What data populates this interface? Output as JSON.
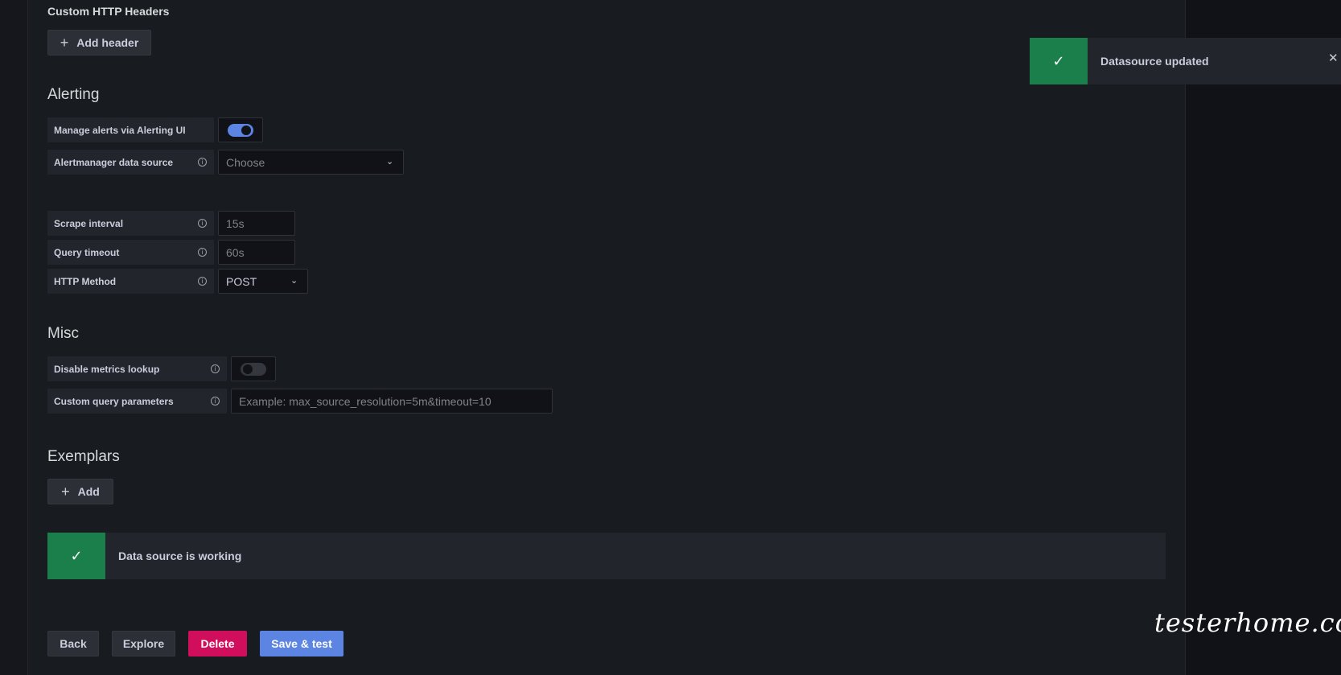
{
  "http_headers": {
    "title": "Custom HTTP Headers",
    "add_header_label": "Add header"
  },
  "alerting": {
    "title": "Alerting",
    "manage_alerts_label": "Manage alerts via Alerting UI",
    "manage_alerts_enabled": true,
    "alertmanager_label": "Alertmanager data source",
    "alertmanager_placeholder": "Choose"
  },
  "settings": {
    "scrape_interval_label": "Scrape interval",
    "scrape_interval_placeholder": "15s",
    "query_timeout_label": "Query timeout",
    "query_timeout_placeholder": "60s",
    "http_method_label": "HTTP Method",
    "http_method_value": "POST"
  },
  "misc": {
    "title": "Misc",
    "disable_metrics_label": "Disable metrics lookup",
    "disable_metrics_enabled": false,
    "custom_query_label": "Custom query parameters",
    "custom_query_placeholder": "Example: max_source_resolution=5m&timeout=10"
  },
  "exemplars": {
    "title": "Exemplars",
    "add_label": "Add"
  },
  "status": {
    "message": "Data source is working"
  },
  "actions": {
    "back": "Back",
    "explore": "Explore",
    "delete": "Delete",
    "save_test": "Save & test"
  },
  "toast": {
    "message": "Datasource updated"
  },
  "watermark": "testerhome.com",
  "colors": {
    "success": "#1a7f4b",
    "primary": "#5b84e3",
    "danger": "#d10e5c",
    "toggle_on": "#5b84e3"
  },
  "icons": {
    "check": "check-icon",
    "plus": "plus-icon",
    "info": "info-icon",
    "chevron": "chevron-down-icon",
    "close": "close-icon"
  }
}
